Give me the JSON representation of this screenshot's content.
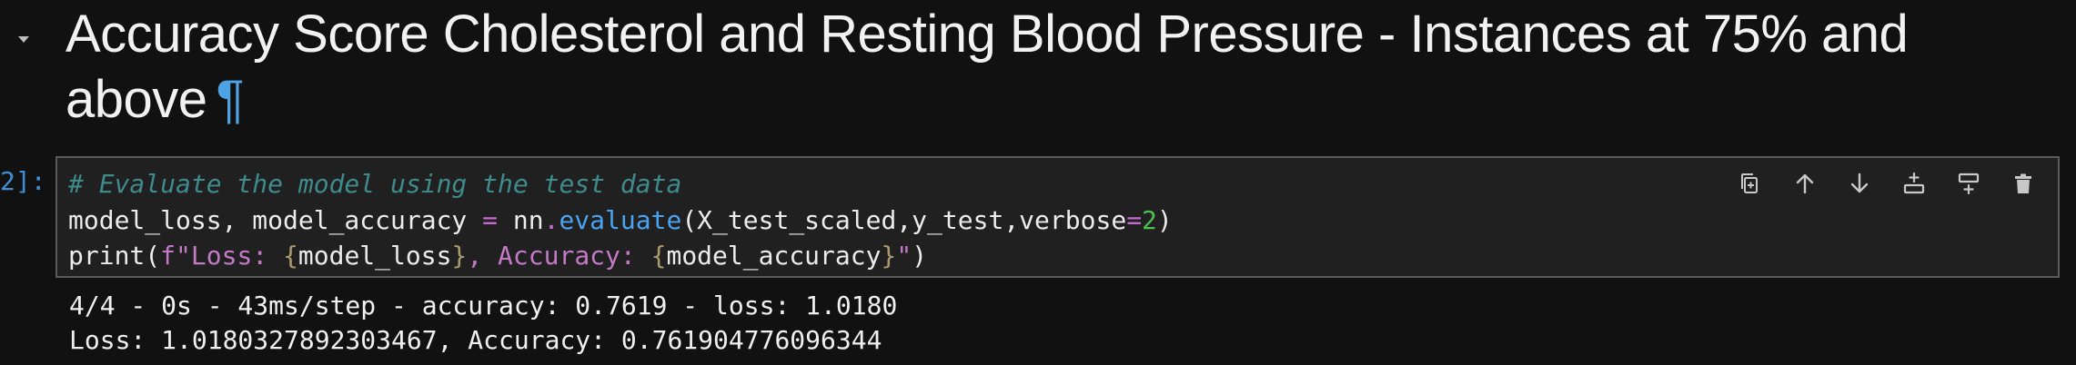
{
  "markdown_cell": {
    "heading_text": "Accuracy Score Cholesterol and Resting Blood Pressure - Instances at 75% and above",
    "anchor_symbol": "¶",
    "toggle_icon": "caret-down-icon"
  },
  "code_cell": {
    "prompt": "2]:",
    "lines": [
      [
        {
          "t": "# Evaluate the model using the test data",
          "c": "tk-comment"
        }
      ],
      [
        {
          "t": "model_loss, model_accuracy ",
          "c": ""
        },
        {
          "t": "=",
          "c": "tk-op"
        },
        {
          "t": " nn",
          "c": ""
        },
        {
          "t": ".",
          "c": "tk-op"
        },
        {
          "t": "evaluate",
          "c": "tk-attr"
        },
        {
          "t": "(X_test_scaled,y_test,verbose",
          "c": ""
        },
        {
          "t": "=",
          "c": "tk-op"
        },
        {
          "t": "2",
          "c": "tk-num"
        },
        {
          "t": ")",
          "c": ""
        }
      ],
      [
        {
          "t": "print(",
          "c": ""
        },
        {
          "t": "f\"Loss: ",
          "c": "tk-str"
        },
        {
          "t": "{",
          "c": "tk-brace"
        },
        {
          "t": "model_loss",
          "c": ""
        },
        {
          "t": "}",
          "c": "tk-brace"
        },
        {
          "t": ", Accuracy: ",
          "c": "tk-str"
        },
        {
          "t": "{",
          "c": "tk-brace"
        },
        {
          "t": "model_accuracy",
          "c": ""
        },
        {
          "t": "}",
          "c": "tk-brace"
        },
        {
          "t": "\"",
          "c": "tk-str"
        },
        {
          "t": ")",
          "c": ""
        }
      ]
    ],
    "toolbar": [
      {
        "name": "duplicate-icon"
      },
      {
        "name": "arrow-up-icon"
      },
      {
        "name": "arrow-down-icon"
      },
      {
        "name": "insert-above-icon"
      },
      {
        "name": "insert-below-icon"
      },
      {
        "name": "trash-icon"
      }
    ]
  },
  "output": {
    "lines": [
      "4/4 - 0s - 43ms/step - accuracy: 0.7619 - loss: 1.0180",
      "Loss: 1.0180327892303467, Accuracy: 0.761904776096344"
    ]
  },
  "colors": {
    "background": "#111111",
    "cell_background": "#202020",
    "cell_border": "#5a5a5a",
    "prompt": "#3f8fd6",
    "anchor": "#4ea3e6"
  }
}
